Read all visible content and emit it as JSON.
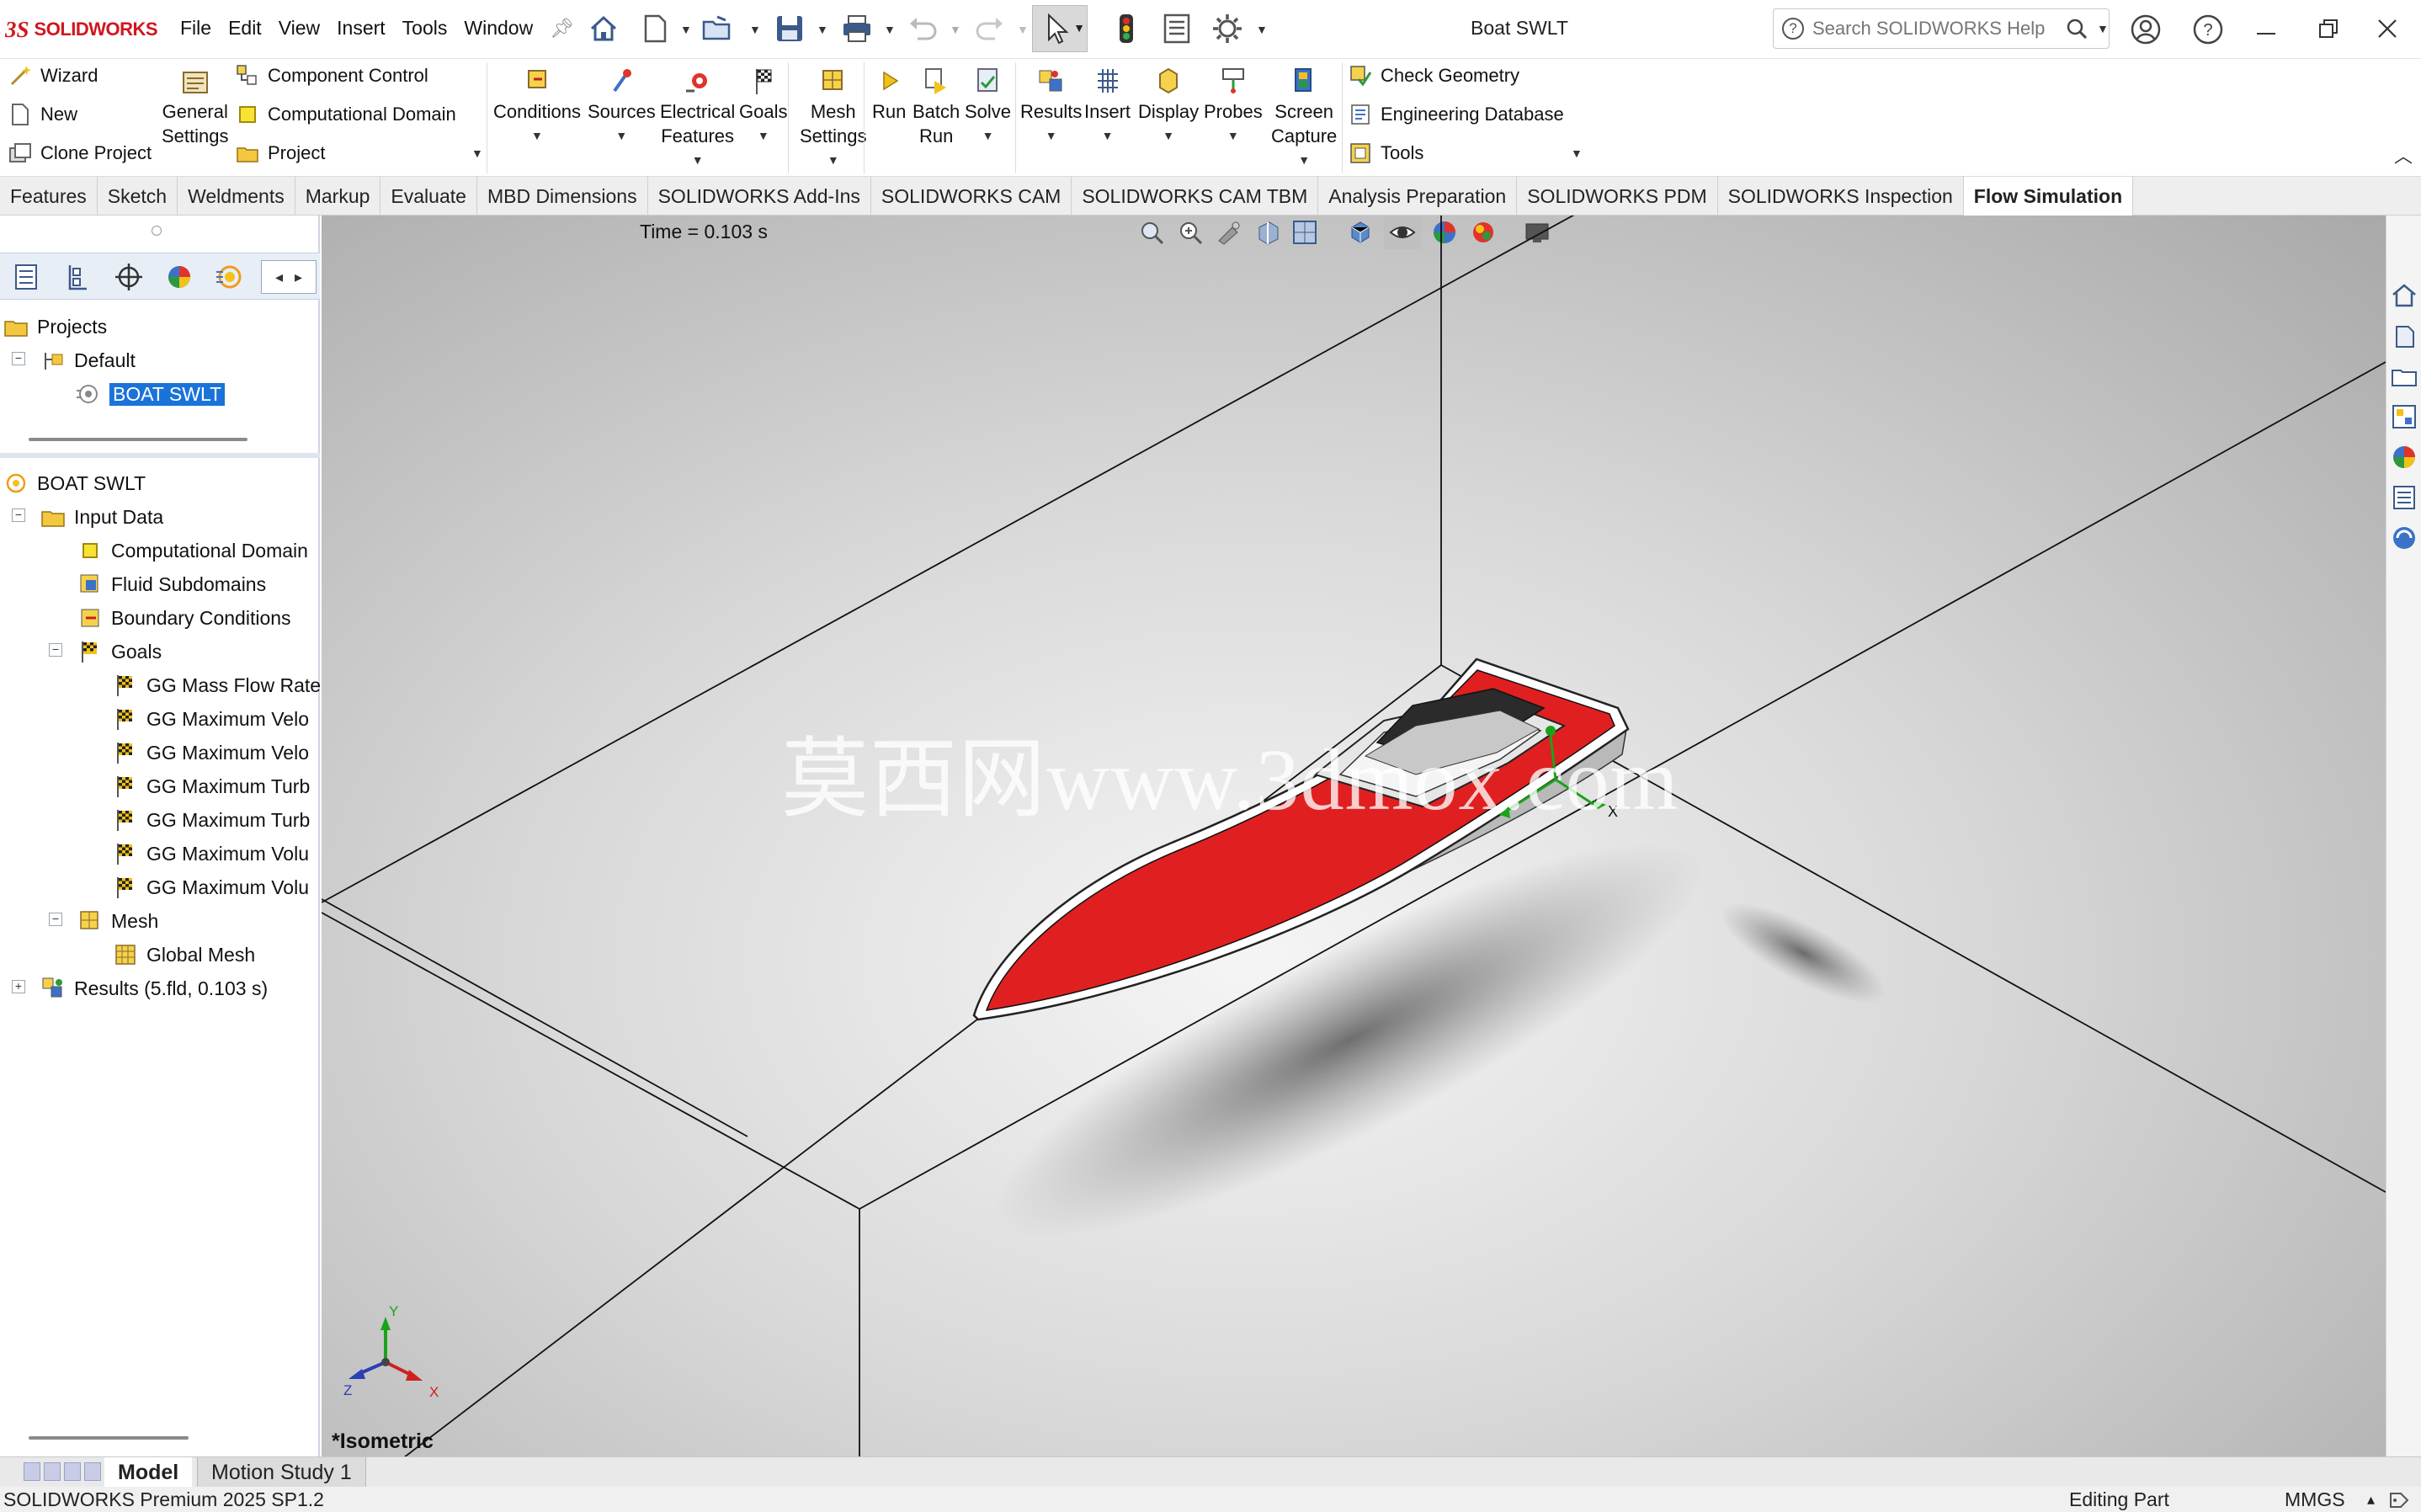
{
  "app": {
    "logo_ds": "3S",
    "logo_text": "SOLIDWORKS",
    "document_title": "Boat SWLT"
  },
  "menu": [
    "File",
    "Edit",
    "View",
    "Insert",
    "Tools",
    "Window"
  ],
  "help_search": {
    "placeholder": "Search SOLIDWORKS Help"
  },
  "command_manager": {
    "left_group": [
      {
        "label": "Wizard",
        "icon": "wand-icon"
      },
      {
        "label": "New",
        "icon": "new-document-icon"
      },
      {
        "label": "Clone Project",
        "icon": "clone-project-icon"
      }
    ],
    "general_settings": "General\nSettings",
    "mid_group": [
      {
        "label": "Component Control",
        "icon": "component-control-icon"
      },
      {
        "label": "Computational Domain",
        "icon": "computational-domain-icon"
      },
      {
        "label": "Project",
        "icon": "project-folder-icon"
      }
    ],
    "big_buttons": [
      {
        "label": "Conditions",
        "icon": "conditions-icon"
      },
      {
        "label": "Sources",
        "icon": "sources-icon"
      },
      {
        "label": "Electrical\nFeatures",
        "icon": "electrical-features-icon"
      },
      {
        "label": "Goals",
        "icon": "goals-flag-icon"
      },
      {
        "label": "Mesh\nSettings",
        "icon": "mesh-settings-icon"
      },
      {
        "label": "Run",
        "icon": "run-icon"
      },
      {
        "label": "Batch\nRun",
        "icon": "batch-run-icon"
      },
      {
        "label": "Solve",
        "icon": "solve-icon"
      },
      {
        "label": "Results",
        "icon": "results-icon"
      },
      {
        "label": "Insert",
        "icon": "insert-grid-icon"
      },
      {
        "label": "Display",
        "icon": "display-icon"
      },
      {
        "label": "Probes",
        "icon": "probes-icon"
      },
      {
        "label": "Screen\nCapture",
        "icon": "screen-capture-icon"
      }
    ],
    "right_group": [
      {
        "label": "Check Geometry",
        "icon": "check-geometry-icon"
      },
      {
        "label": "Engineering Database",
        "icon": "engineering-database-icon"
      },
      {
        "label": "Tools",
        "icon": "tools-icon"
      }
    ]
  },
  "tabs": [
    {
      "label": "Features",
      "active": false
    },
    {
      "label": "Sketch",
      "active": false
    },
    {
      "label": "Weldments",
      "active": false
    },
    {
      "label": "Markup",
      "active": false
    },
    {
      "label": "Evaluate",
      "active": false
    },
    {
      "label": "MBD Dimensions",
      "active": false
    },
    {
      "label": "SOLIDWORKS Add-Ins",
      "active": false
    },
    {
      "label": "SOLIDWORKS CAM",
      "active": false
    },
    {
      "label": "SOLIDWORKS CAM TBM",
      "active": false
    },
    {
      "label": "Analysis Preparation",
      "active": false
    },
    {
      "label": "SOLIDWORKS PDM",
      "active": false
    },
    {
      "label": "SOLIDWORKS Inspection",
      "active": false
    },
    {
      "label": "Flow Simulation",
      "active": true
    }
  ],
  "projects_tree": {
    "root": "Projects",
    "config": "Default",
    "project": "BOAT SWLT"
  },
  "analysis_tree": {
    "root": "BOAT SWLT",
    "input_data": "Input Data",
    "items": [
      "Computational Domain",
      "Fluid Subdomains",
      "Boundary Conditions"
    ],
    "goals": "Goals",
    "goal_items": [
      "GG Mass Flow Rate",
      "GG Maximum Velo",
      "GG Maximum Velo",
      "GG Maximum Turb",
      "GG Maximum Turb",
      "GG Maximum Volu",
      "GG Maximum Volu"
    ],
    "mesh": "Mesh",
    "global_mesh": "Global Mesh",
    "results": "Results (5.fld, 0.103 s)"
  },
  "viewport": {
    "time_label": "Time = 0.103 s",
    "view_name": "*Isometric",
    "watermark": "莫西网www.3dmox.com",
    "axis_x": "X",
    "axis_y": "Y",
    "axis_z": "Z",
    "boat_color": "#e02020"
  },
  "bottom_tabs": [
    "Model",
    "Motion Study 1"
  ],
  "status": {
    "left": "SOLIDWORKS Premium 2025 SP1.2",
    "mode": "Editing Part",
    "units": "MMGS"
  }
}
